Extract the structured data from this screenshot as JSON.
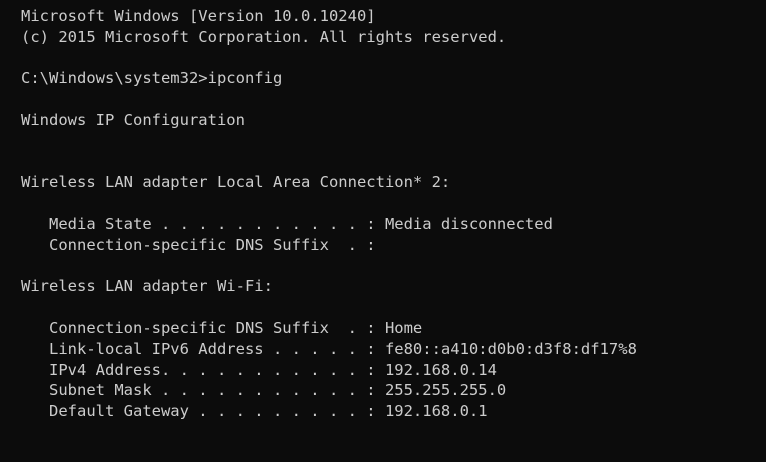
{
  "console": {
    "lines": {
      "header_version": "Microsoft Windows [Version 10.0.10240]",
      "header_copyright": "(c) 2015 Microsoft Corporation. All rights reserved.",
      "prompt_command": "C:\\Windows\\system32>ipconfig",
      "ip_config_title": "Windows IP Configuration",
      "adapter_local_title": "Wireless LAN adapter Local Area Connection* 2:",
      "local_media_state": "   Media State . . . . . . . . . . . : Media disconnected",
      "local_dns_suffix": "   Connection-specific DNS Suffix  . :",
      "adapter_wifi_title": "Wireless LAN adapter Wi-Fi:",
      "wifi_dns_suffix": "   Connection-specific DNS Suffix  . : Home",
      "wifi_ipv6": "   Link-local IPv6 Address . . . . . : fe80::a410:d0b0:d3f8:df17%8",
      "wifi_ipv4": "   IPv4 Address. . . . . . . . . . . : 192.168.0.14",
      "wifi_subnet": "   Subnet Mask . . . . . . . . . . . : 255.255.255.0",
      "wifi_gateway": "   Default Gateway . . . . . . . . . : 192.168.0.1"
    }
  }
}
